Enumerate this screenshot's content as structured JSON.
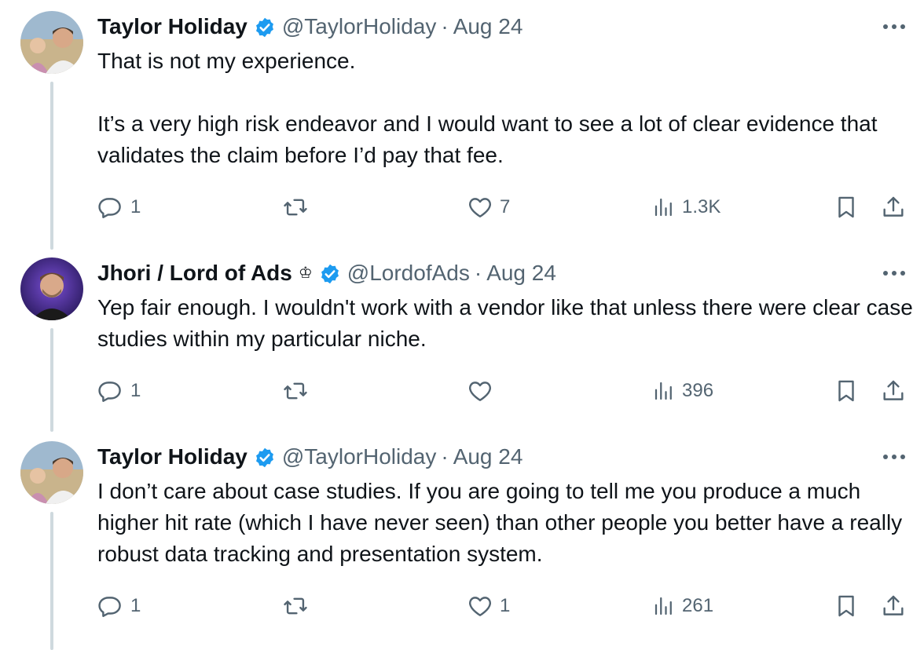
{
  "tweets": [
    {
      "author": {
        "name": "Taylor Holiday",
        "handle": "@TaylorHoliday",
        "verified": true,
        "crown": ""
      },
      "date": "Aug 24",
      "separator": "·",
      "text": [
        "That is not my experience.",
        "It’s a very high risk endeavor and I would want to see a lot of clear evidence that validates the claim before I’d pay that fee."
      ],
      "stats": {
        "replies": "1",
        "reposts": "",
        "likes": "7",
        "views": "1.3K"
      }
    },
    {
      "author": {
        "name": "Jhori / Lord of Ads",
        "handle": "@LordofAds",
        "verified": true,
        "crown": "♔"
      },
      "date": "Aug 24",
      "separator": "·",
      "text": [
        "Yep fair enough. I wouldn't work with a vendor like that unless there were clear case studies within my particular niche."
      ],
      "stats": {
        "replies": "1",
        "reposts": "",
        "likes": "",
        "views": "396"
      }
    },
    {
      "author": {
        "name": "Taylor Holiday",
        "handle": "@TaylorHoliday",
        "verified": true,
        "crown": ""
      },
      "date": "Aug 24",
      "separator": "·",
      "text": [
        "I don’t care about case studies. If you are going to tell me you produce a much higher hit rate (which I have never seen) than other people you better have a really robust data tracking and presentation system."
      ],
      "stats": {
        "replies": "1",
        "reposts": "",
        "likes": "1",
        "views": "261"
      }
    }
  ],
  "colors": {
    "text": "#0f1419",
    "secondary": "#536471",
    "verified": "#1d9bf0",
    "thread_line": "#cfd9de"
  },
  "icons": [
    "verified-badge-icon",
    "more-icon",
    "reply-icon",
    "repost-icon",
    "like-icon",
    "views-icon",
    "bookmark-icon",
    "share-icon"
  ]
}
